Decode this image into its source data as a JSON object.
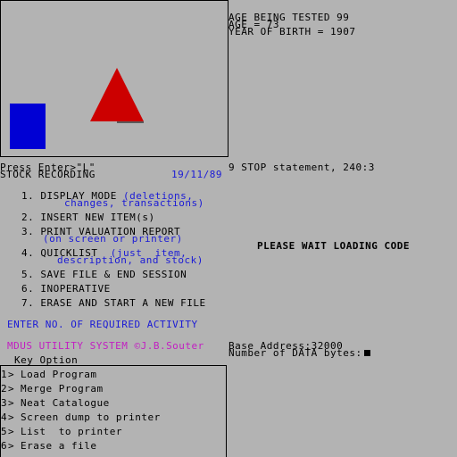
{
  "colors": {
    "background": "#b3b3b3",
    "text": "#000000",
    "highlight_blue": "#1a1ad6",
    "magenta": "#c21ec2",
    "shape_blue": "#0000d4",
    "shape_red": "#cc0000"
  },
  "status": {
    "line1": "AGE BEING TESTED 99",
    "line2": "AGE = 73",
    "line3": "YEAR OF BIRTH = 1907"
  },
  "prompt": {
    "press_enter": "Press Enter>\"L\"",
    "stop_statement": "9 STOP statement, 240:3"
  },
  "stock": {
    "title": "STOCK RECORDING",
    "date": "19/11/89",
    "items": [
      {
        "num": "1.",
        "label": "DISPLAY MODE",
        "sub1": "(deletions,",
        "sub2": "changes, transactions)"
      },
      {
        "num": "2.",
        "label": "INSERT NEW ITEM(s)"
      },
      {
        "num": "3.",
        "label": "PRINT VALUATION REPORT",
        "sub1": "(on screen or printer)"
      },
      {
        "num": "4.",
        "label": "QUICKLIST",
        "sub1": "(just  item,",
        "sub2": "description, and stock)"
      },
      {
        "num": "5.",
        "label": "SAVE FILE & END SESSION"
      },
      {
        "num": "6.",
        "label": "INOPERATIVE"
      },
      {
        "num": "7.",
        "label": "ERASE AND START A NEW FILE"
      }
    ],
    "enter_prompt": "ENTER NO. OF REQUIRED ACTIVITY"
  },
  "loading": "PLEASE WAIT LOADING CODE",
  "utility": {
    "title": "MDUS UTILITY SYSTEM ©J.B.Souter",
    "base_address": "Base Address:32000",
    "data_bytes": "Number of DATA bytes:",
    "header": "Key Option",
    "options": [
      {
        "key": "1",
        "label": "Load Program"
      },
      {
        "key": "2",
        "label": "Merge Program"
      },
      {
        "key": "3",
        "label": "Neat Catalogue"
      },
      {
        "key": "4",
        "label": "Screen dump to printer"
      },
      {
        "key": "5",
        "label": "List  to printer"
      },
      {
        "key": "6",
        "label": "Erase a file"
      }
    ]
  }
}
